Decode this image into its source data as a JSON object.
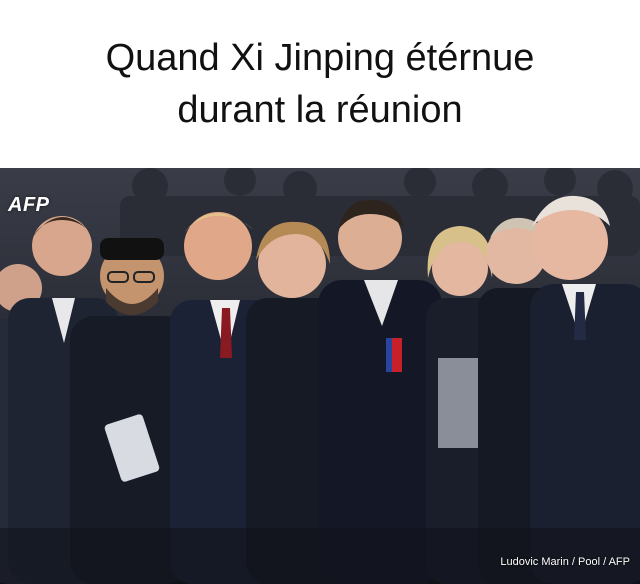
{
  "caption": {
    "line1": "Quand Xi Jinping étérnue",
    "line2": "durant la réunion"
  },
  "photo": {
    "agency_logo": "AFP",
    "credit": "Ludovic Marin / Pool / AFP"
  },
  "colors": {
    "background": "#ffffff",
    "caption_text": "#111111",
    "coat_dark": "#1b2030",
    "skin": "#d9a98a"
  }
}
